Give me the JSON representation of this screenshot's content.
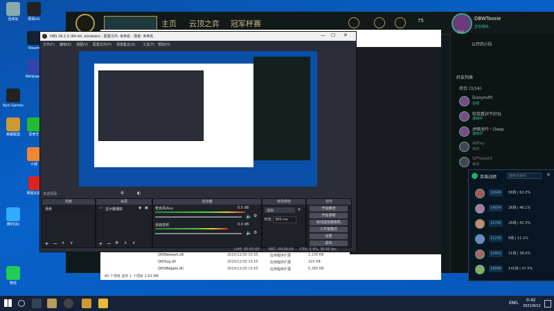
{
  "desktop": {
    "icons": [
      {
        "label": "回收站",
        "color": "#8aa"
      },
      {
        "label": "Epic Games",
        "color": "#222"
      },
      {
        "label": "腾讯QQ",
        "color": "#3af"
      },
      {
        "label": "英雄联盟",
        "color": "#c93"
      },
      {
        "label": "网易云音乐",
        "color": "#d22"
      },
      {
        "label": "微信",
        "color": "#2c5"
      }
    ],
    "icons2": [
      {
        "label": "网易UU",
        "color": "#222"
      },
      {
        "label": "Steam",
        "color": "#123"
      },
      {
        "label": "Wallpaper",
        "color": "#34a"
      },
      {
        "label": "爱奇艺",
        "color": "#2b3"
      },
      {
        "label": "火绒",
        "color": "#e83"
      }
    ]
  },
  "taskbar": {
    "time": "0:42",
    "date": "2021/9/12",
    "lang": "ENG"
  },
  "lol": {
    "nav": [
      "主页",
      "云顶之弈",
      "冠军杯赛"
    ],
    "currency": "75",
    "profile": {
      "name": "DBWTaosie",
      "status": "正在观战...",
      "level": "314"
    },
    "friends_header": "好友列表",
    "group": "综合 (3/14)",
    "team_label": "公开的小队",
    "friends": [
      {
        "name": "Duoyouth",
        "status": "在线"
      },
      {
        "name": "哈我看好不好玩",
        "status": "游戏中"
      },
      {
        "name": "虎啸龙吟丶Deep",
        "status": "游戏中"
      },
      {
        "name": "AbFay",
        "status": "离线"
      },
      {
        "name": "QPhasent",
        "status": "离线"
      }
    ],
    "side_btn": "退出"
  },
  "explorer": {
    "files": [
      {
        "name": "Qt5Network.dll",
        "date": "2020/12/30 15:55",
        "type": "应用程序扩展",
        "size": "1,235 KB"
      },
      {
        "name": "Qt5Svg.dll",
        "date": "2020/12/30 15:55",
        "type": "应用程序扩展",
        "size": "325 KB"
      },
      {
        "name": "Qt5Widgets.dll",
        "date": "2020/12/30 15:55",
        "type": "应用程序扩展",
        "size": "5,385 KB"
      }
    ],
    "status": "60 个项目    选中 1 个项目  2.63 MB"
  },
  "obs": {
    "title": "OBS 26.1.0 (64-bit, windows) - 配置文件: 未命名 - 场景: 未命名",
    "menu": [
      "文件(F)",
      "编辑(E)",
      "视图(V)",
      "配置文件(P)",
      "场景集合(S)",
      "工具(T)",
      "帮助(H)"
    ],
    "docks": {
      "scenes": "场景",
      "sources": "来源",
      "mixer": "混音器",
      "transitions": "转场特效",
      "controls": "控件"
    },
    "scene_item": "场景",
    "source_item": "显示器捕获",
    "no_source": "未选择源",
    "mixer_rows": [
      {
        "name": "麦克风/Aux",
        "db": "0.0 dB"
      },
      {
        "name": "桌面音频",
        "db": "0.0 dB"
      }
    ],
    "transition": {
      "type": "淡出",
      "duration_label": "时长",
      "duration": "300 ms"
    },
    "controls": [
      "开始推流",
      "开始录制",
      "启动虚拟摄像机",
      "工作室模式",
      "设置",
      "退出"
    ],
    "statusbar": {
      "live": "LIVE: 00:00:00",
      "rec": "REC: 00:00:00",
      "cpu": "CPU: 5.4%, 30.00 fps"
    }
  },
  "match": {
    "title": "英雄战绩",
    "search_placeholder": "搜索召唤师",
    "rows": [
      {
        "score": "16946",
        "wr": "58场 | 62.0%"
      },
      {
        "score": "14054",
        "wr": "26场 | 46.1%"
      },
      {
        "score": "12782",
        "wr": "26场 | 42.3%"
      },
      {
        "score": "11226",
        "wr": "9场 | 11.1%"
      },
      {
        "score": "12401",
        "wr": "21场 | 38.0%"
      },
      {
        "score": "18066",
        "wr": "141场 | 47.5%"
      }
    ]
  }
}
